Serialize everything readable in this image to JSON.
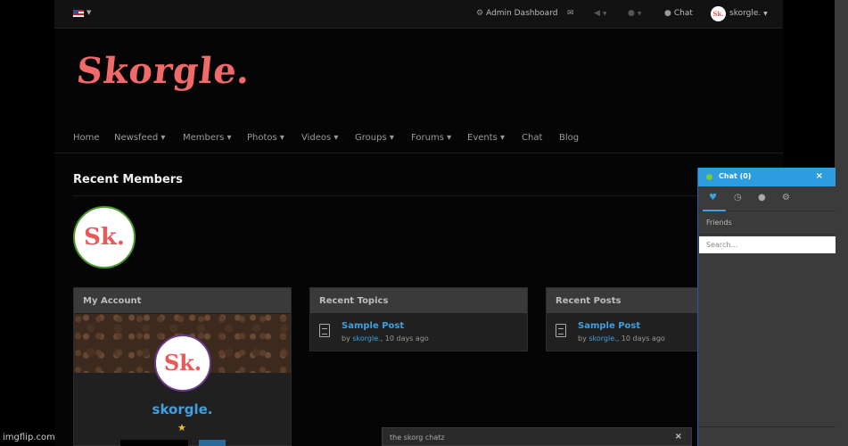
{
  "topbar": {
    "admin_label": "Admin Dashboard",
    "chat_label": "Chat",
    "user_label": "skorgle.",
    "avatar_text": "Sk."
  },
  "logo": "Skorgle.",
  "nav": {
    "items": [
      {
        "label": "Home"
      },
      {
        "label": "Newsfeed ▾"
      },
      {
        "label": "Members ▾"
      },
      {
        "label": "Photos ▾"
      },
      {
        "label": "Videos ▾"
      },
      {
        "label": "Groups ▾"
      },
      {
        "label": "Forums ▾"
      },
      {
        "label": "Events ▾"
      },
      {
        "label": "Chat"
      },
      {
        "label": "Blog"
      }
    ]
  },
  "recent_members": {
    "title": "Recent Members",
    "avatar_text": "Sk."
  },
  "my_account": {
    "title": "My Account",
    "avatar_text": "Sk.",
    "name": "skorgle."
  },
  "recent_topics": {
    "title": "Recent Topics",
    "item_title": "Sample Post",
    "by": "by",
    "author": "skorgle.",
    "time": ", 10 days ago"
  },
  "recent_posts": {
    "title": "Recent Posts",
    "item_title": "Sample Post",
    "by": "by",
    "author": "skorgle.",
    "time": ", 10 days ago"
  },
  "chat_popup": {
    "title": "the skorg chatz",
    "close": "×"
  },
  "chat_panel": {
    "title": "Chat (0)",
    "close": "×",
    "friends_label": "Friends",
    "search_placeholder": "Search..."
  },
  "watermark": "imgflip.com"
}
